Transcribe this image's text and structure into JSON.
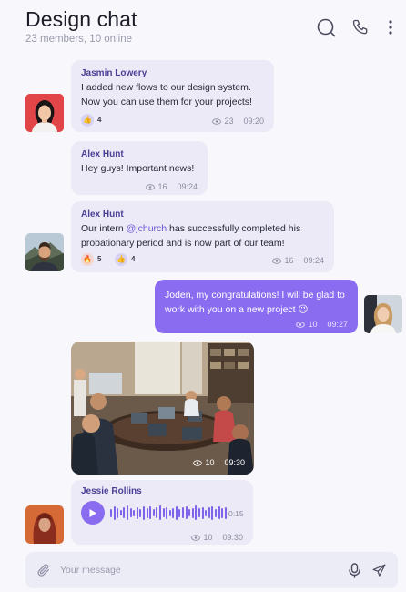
{
  "header": {
    "title": "Design chat",
    "subtitle": "23 members, 10 online",
    "icons": [
      "search-icon",
      "phone-icon",
      "more-vertical-icon"
    ]
  },
  "messages": [
    {
      "sender": "Jasmin Lowery",
      "text": "I added new flows to our design system. Now you can use them for your projects!",
      "reactions": [
        {
          "emoji": "👍",
          "count": "4"
        }
      ],
      "views": "23",
      "time": "09:20"
    },
    {
      "sender": "Alex Hunt",
      "text": "Hey guys! Important news!",
      "views": "16",
      "time": "09:24"
    },
    {
      "sender": "Alex Hunt",
      "text_before": "Our intern ",
      "mention": "@jchurch",
      "text_after": " has successfully completed his probationary period and is now part of our team!",
      "reactions": [
        {
          "emoji": "🔥",
          "count": "5"
        },
        {
          "emoji": "👍",
          "count": "4"
        }
      ],
      "views": "16",
      "time": "09:24"
    },
    {
      "own": true,
      "text": "Joden, my congratulations! I will be glad to work with you on a new project 😉",
      "views": "10",
      "time": "09:27"
    },
    {
      "type": "image",
      "views": "10",
      "time": "09:30"
    },
    {
      "sender": "Jessie Rollins",
      "type": "voice",
      "duration": "0:15",
      "views": "10",
      "time": "09:30"
    }
  ],
  "composer": {
    "placeholder": "Your message",
    "value": "",
    "icons": [
      "paperclip-icon",
      "microphone-icon",
      "send-icon"
    ]
  },
  "colors": {
    "accent": "#8a6cf0",
    "bubble": "#ebeaf6",
    "background": "#f8f8fc",
    "sender_name": "#4a3f96"
  }
}
